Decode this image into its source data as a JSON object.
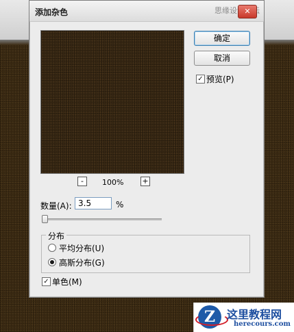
{
  "window": {
    "title": "添加杂色",
    "watermark": "思缘设计论坛",
    "close_glyph": "✕"
  },
  "buttons": {
    "ok": "确定",
    "cancel": "取消"
  },
  "preview_option": {
    "label": "预览(P)",
    "checked": true,
    "check_glyph": "✓"
  },
  "zoom": {
    "minus": "-",
    "plus": "+",
    "level": "100%"
  },
  "amount": {
    "label": "数量(A):",
    "value": "3.5",
    "unit": "%"
  },
  "distribution": {
    "title": "分布",
    "uniform_label": "平均分布(U)",
    "gaussian_label": "高斯分布(G)",
    "selected": "gaussian"
  },
  "monochromatic": {
    "label": "单色(M)",
    "checked": true
  },
  "logo": {
    "mark": "Z",
    "title": "这里教程网",
    "subtitle": "herecours.com"
  },
  "colors": {
    "noise_brown": "#3a2914",
    "accent_blue": "#3c7fb1"
  }
}
